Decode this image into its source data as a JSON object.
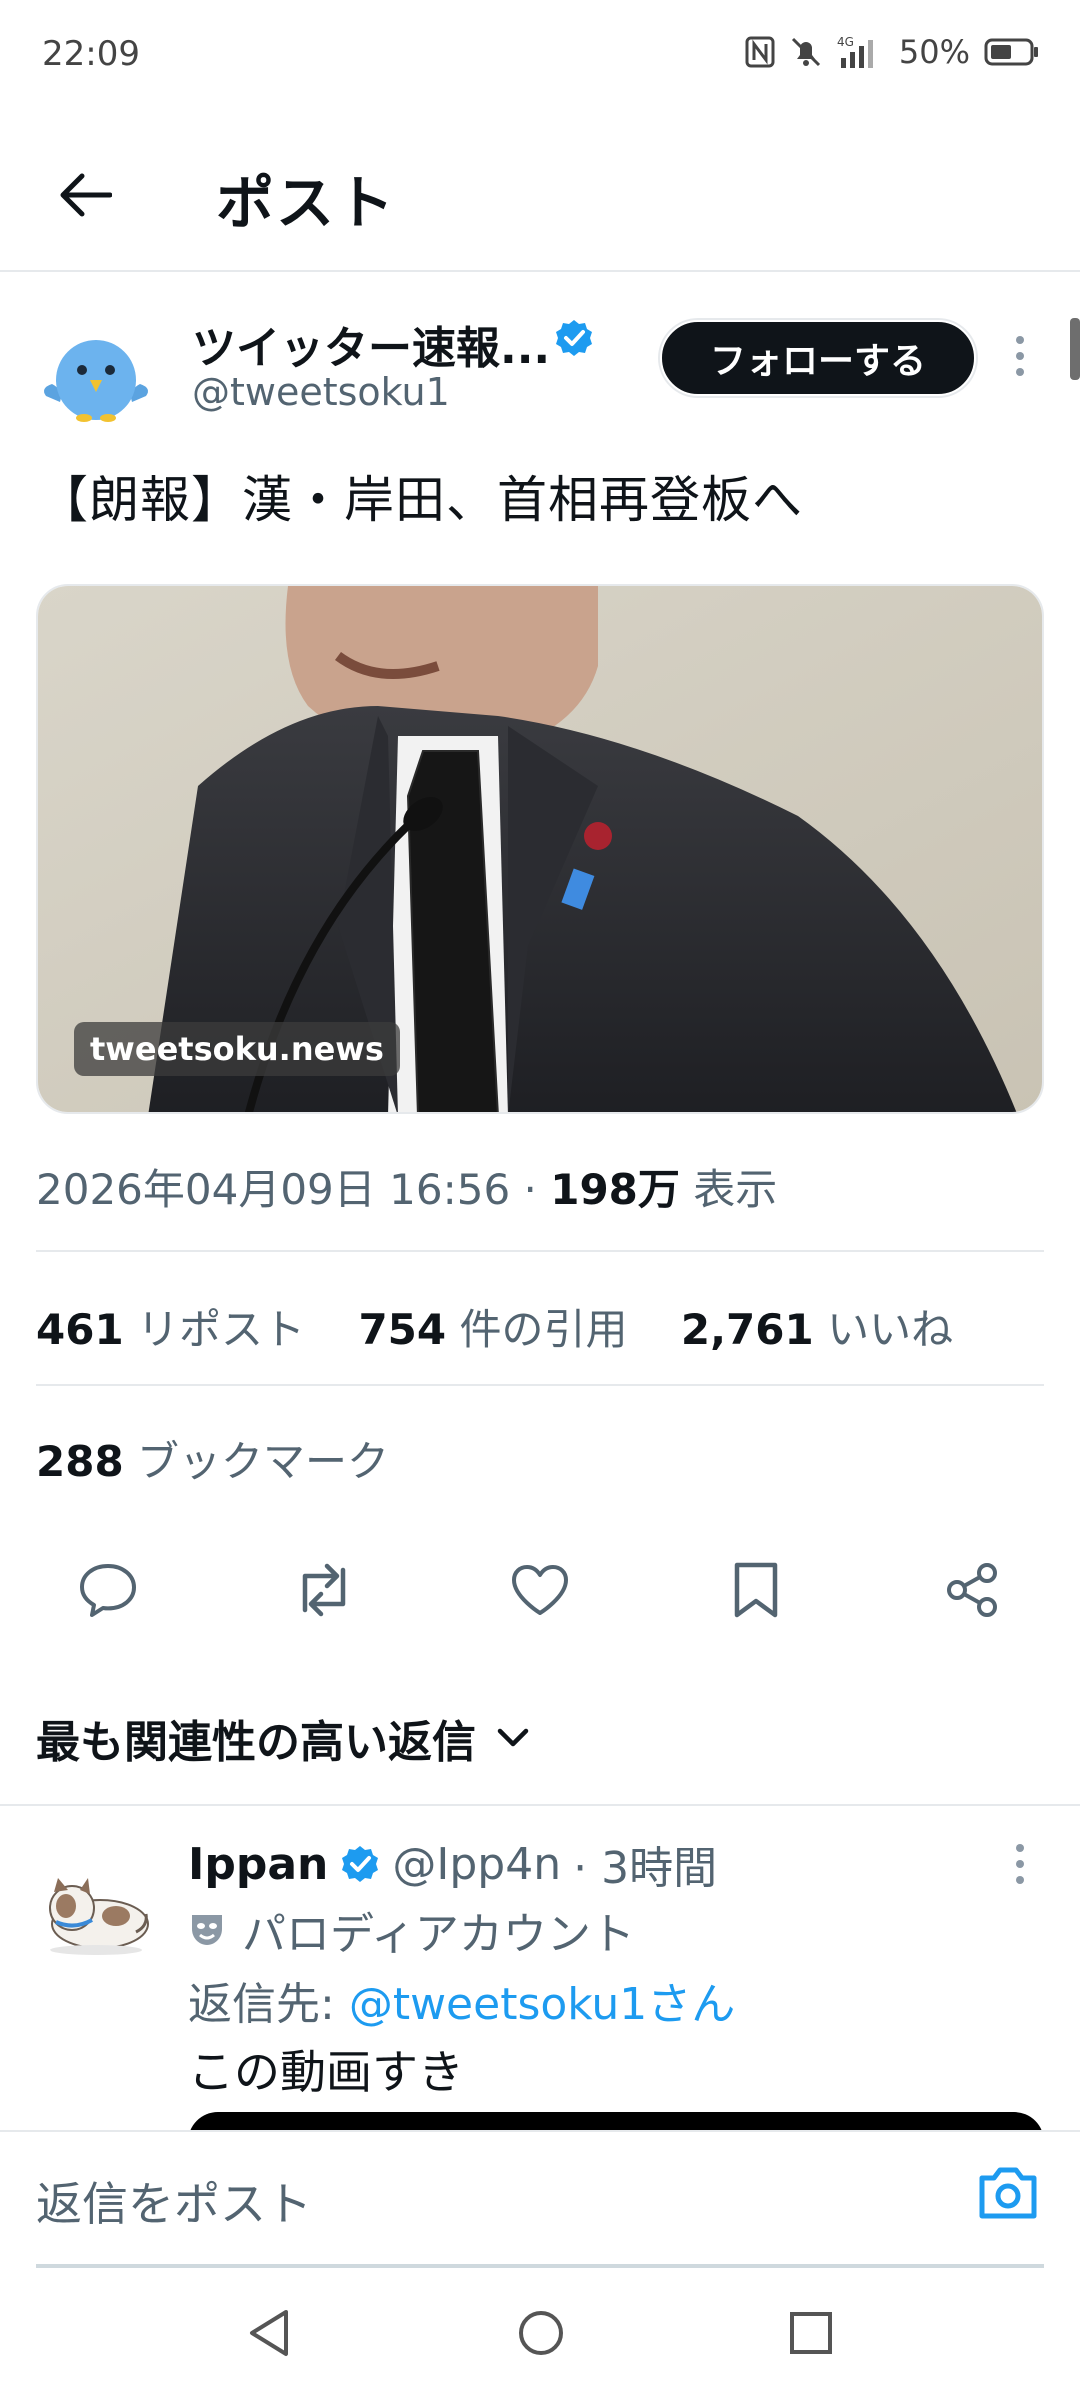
{
  "status_bar": {
    "time": "22:09",
    "battery": "50%",
    "icons": [
      "nfc-icon",
      "mute-bell-icon",
      "signal-4g-icon",
      "battery-icon"
    ]
  },
  "header": {
    "title": "ポスト",
    "back_icon": "arrow-left-icon"
  },
  "post": {
    "author_name": "ツイッター速報...",
    "author_handle": "@tweetsoku1",
    "follow_label": "フォローする",
    "text": "【朗報】漢・岸田、首相再登板へ",
    "media_watermark": "tweetsoku.news",
    "timestamp": "2026年04月09日 16:56 · ",
    "views_count": "198万",
    "views_label": " 表示",
    "stats": {
      "reposts_count": "461",
      "reposts_label": " リポスト",
      "quotes_count": "754",
      "quotes_label": " 件の引用",
      "likes_count": "2,761",
      "likes_label": " いいね",
      "bookmarks_count": "288",
      "bookmarks_label": " ブックマーク"
    },
    "actions": [
      "reply-icon",
      "repost-icon",
      "like-icon",
      "bookmark-icon",
      "share-icon"
    ]
  },
  "replies": {
    "sort_label": "最も関連性の高い返信",
    "items": [
      {
        "name": "Ippan",
        "handle": "@Ipp4n",
        "time": "· 3時間",
        "parody_label": "パロディアカウント",
        "reply_to_prefix": "返信先: ",
        "reply_to_handle": "@tweetsoku1さん",
        "text": "この動画すき"
      }
    ]
  },
  "compose": {
    "placeholder": "返信をポスト"
  },
  "colors": {
    "accent": "#1d9bf0",
    "text_primary": "#0f1419",
    "text_secondary": "#536471",
    "divider": "#e6e9ec"
  }
}
